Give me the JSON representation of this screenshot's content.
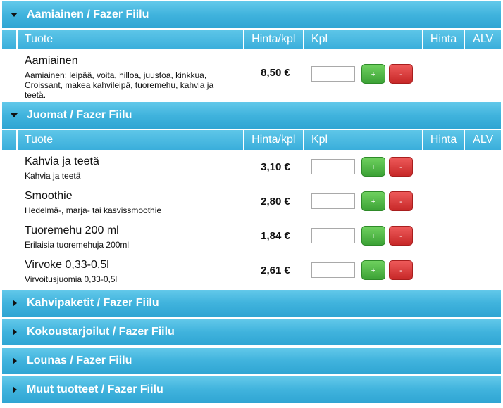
{
  "columns": {
    "tuote": "Tuote",
    "hinta_kpl": "Hinta/kpl",
    "kpl": "Kpl",
    "hinta": "Hinta",
    "alv": "ALV"
  },
  "sections": [
    {
      "title": "Aamiainen / Fazer Fiilu",
      "expanded": true,
      "products": [
        {
          "name": "Aamiainen",
          "description": "Aamiainen: leipää, voita, hilloa, juustoa, kinkkua, Croissant, makea kahvileipä, tuoremehu, kahvia ja teetä.",
          "price": "8,50 €",
          "quantity": ""
        }
      ]
    },
    {
      "title": "Juomat / Fazer Fiilu",
      "expanded": true,
      "products": [
        {
          "name": "Kahvia ja teetä",
          "description": "Kahvia ja teetä",
          "price": "3,10 €",
          "quantity": ""
        },
        {
          "name": "Smoothie",
          "description": "Hedelmä-, marja- tai kasvissmoothie",
          "price": "2,80 €",
          "quantity": ""
        },
        {
          "name": "Tuoremehu 200 ml",
          "description": "Erilaisia tuoremehuja 200ml",
          "price": "1,84 €",
          "quantity": ""
        },
        {
          "name": "Virvoke 0,33-0,5l",
          "description": "Virvoitusjuomia 0,33-0,5l",
          "price": "2,61 €",
          "quantity": ""
        }
      ]
    },
    {
      "title": "Kahvipaketit / Fazer Fiilu",
      "expanded": false
    },
    {
      "title": "Kokoustarjoilut / Fazer Fiilu",
      "expanded": false
    },
    {
      "title": "Lounas / Fazer Fiilu",
      "expanded": false
    },
    {
      "title": "Muut tuotteet / Fazer Fiilu",
      "expanded": false
    }
  ],
  "buttons": {
    "plus": "+",
    "minus": "-"
  },
  "icons": {
    "expanded": "caret-down-icon",
    "collapsed": "caret-right-icon"
  },
  "colors": {
    "header": "#40b3dd",
    "plus": "#3ca236",
    "minus": "#c72828"
  }
}
